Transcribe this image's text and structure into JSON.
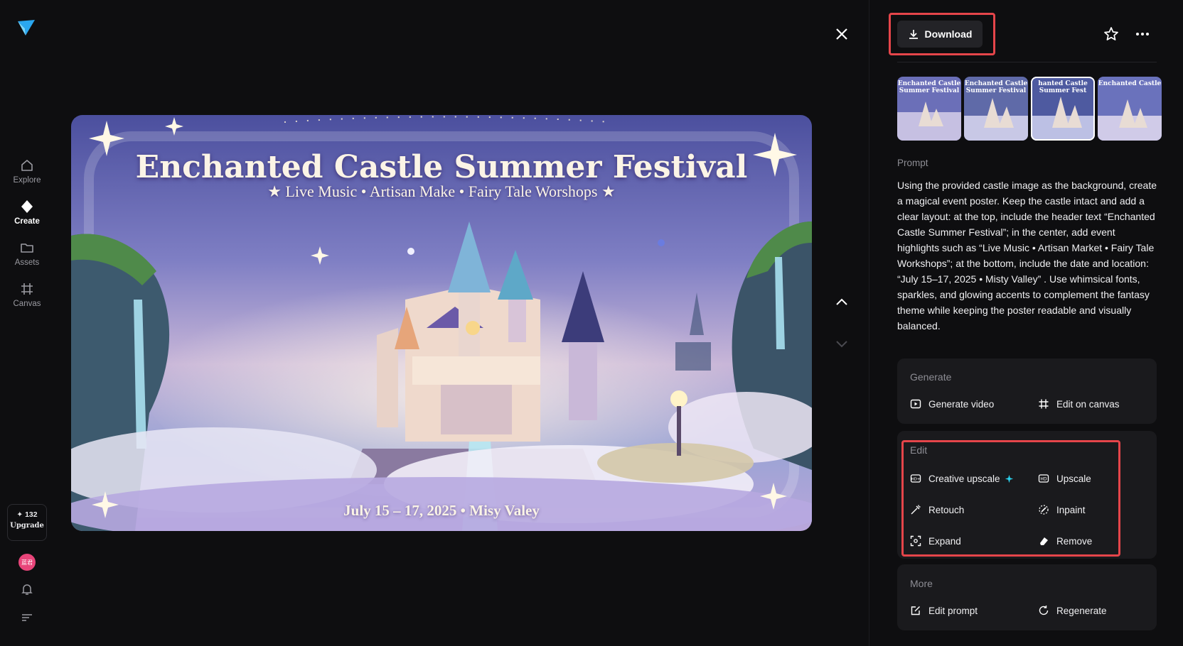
{
  "nav": {
    "items": [
      {
        "label": "Explore",
        "icon": "home-icon"
      },
      {
        "label": "Create",
        "icon": "diamond-icon"
      },
      {
        "label": "Assets",
        "icon": "folder-icon"
      },
      {
        "label": "Canvas",
        "icon": "canvas-icon"
      }
    ],
    "credits": "✦ 132",
    "upgrade": "Upgrade",
    "avatar": "蓝君"
  },
  "poster": {
    "title": "Enchanted Castle Summer Festival",
    "subtitle": "★  Live Music  •  Artisan Make  •  Fairy Tale Worshops  ★",
    "date": "July 15 – 17, 2025 • Misy Valey"
  },
  "panel": {
    "download_label": "Download",
    "thumbnails": [
      {
        "title": "Enchanted Castle Summer Festival",
        "selected": false
      },
      {
        "title": "Enchanted Castle Summer Festival",
        "selected": false
      },
      {
        "title": "hanted Castle Summer Fest",
        "selected": true
      },
      {
        "title": "Enchanted Castle",
        "selected": false
      }
    ],
    "prompt_heading": "Prompt",
    "prompt_text": "Using the provided castle image as the background, create a magical event poster. Keep the castle intact and add a clear layout: at the top, include the header text “Enchanted Castle Summer Festival”; in the center, add event highlights such as “Live Music • Artisan Market • Fairy Tale Workshops”; at the bottom, include the date and location: “July 15–17, 2025 • Misty Valley” . Use whimsical fonts, sparkles, and glowing accents to complement the fantasy theme while keeping the poster readable and visually balanced.",
    "generate": {
      "heading": "Generate",
      "generate_video": "Generate video",
      "edit_on_canvas": "Edit on canvas"
    },
    "edit": {
      "heading": "Edit",
      "creative_upscale": "Creative upscale",
      "upscale": "Upscale",
      "retouch": "Retouch",
      "inpaint": "Inpaint",
      "expand": "Expand",
      "remove": "Remove"
    },
    "more": {
      "heading": "More",
      "edit_prompt": "Edit prompt",
      "regenerate": "Regenerate"
    }
  },
  "colors": {
    "accent": "#e5454a",
    "sparkle": "#2ad4f0"
  }
}
